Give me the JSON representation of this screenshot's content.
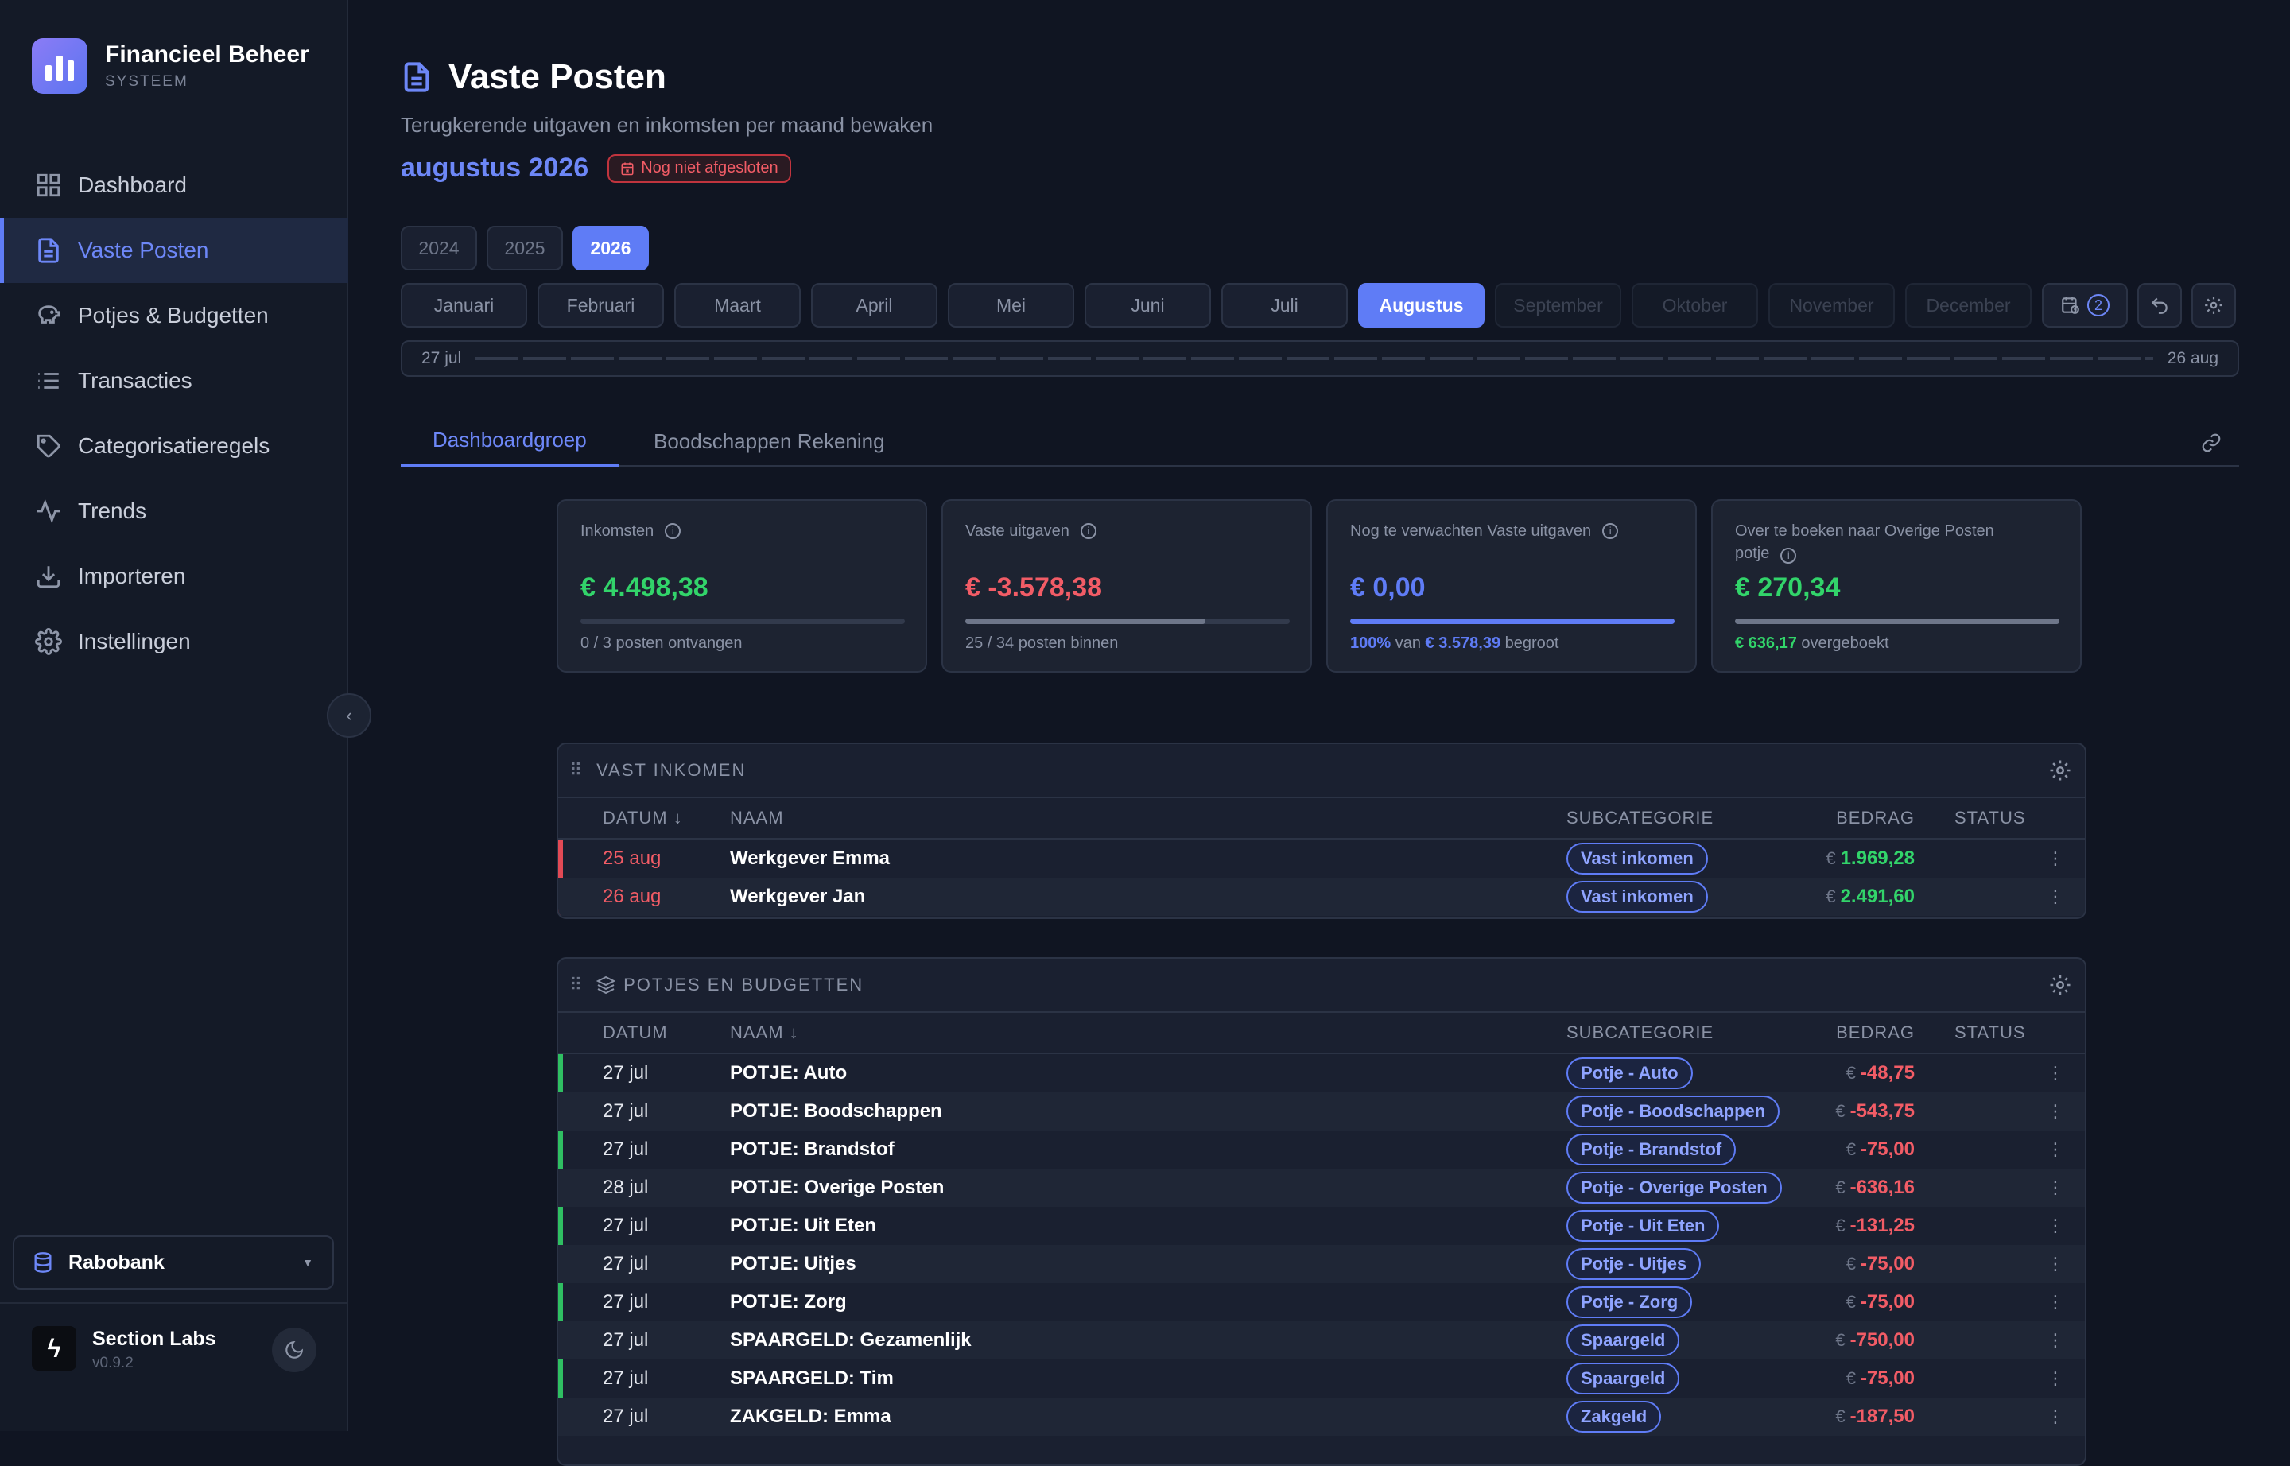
{
  "app": {
    "title": "Financieel Beheer",
    "subtitle": "SYSTEEM"
  },
  "sidebar": {
    "items": [
      {
        "label": "Dashboard",
        "icon": "grid-icon"
      },
      {
        "label": "Vaste Posten",
        "icon": "document-icon"
      },
      {
        "label": "Potjes & Budgetten",
        "icon": "piggy-bank-icon"
      },
      {
        "label": "Transacties",
        "icon": "list-icon"
      },
      {
        "label": "Categorisatieregels",
        "icon": "tag-icon"
      },
      {
        "label": "Trends",
        "icon": "activity-icon"
      },
      {
        "label": "Importeren",
        "icon": "download-icon"
      },
      {
        "label": "Instellingen",
        "icon": "gear-icon"
      }
    ],
    "collapse_glyph": "‹",
    "bank": "Rabobank",
    "company": "Section Labs",
    "version": "v0.9.2"
  },
  "header": {
    "title": "Vaste Posten",
    "subtitle": "Terugkerende uitgaven en inkomsten per maand bewaken",
    "month": "augustus 2026",
    "status_badge": "Nog niet afgesloten"
  },
  "years": [
    "2024",
    "2025",
    "2026"
  ],
  "active_year": "2026",
  "months": [
    "Januari",
    "Februari",
    "Maart",
    "April",
    "Mei",
    "Juni",
    "Juli",
    "Augustus",
    "September",
    "Oktober",
    "November",
    "December"
  ],
  "active_month": "Augustus",
  "pending_count": "2",
  "timeline": {
    "start": "27 jul",
    "end": "26 aug"
  },
  "tabs": [
    "Dashboardgroep",
    "Boodschappen Rekening"
  ],
  "cards": [
    {
      "label": "Inkomsten",
      "value": "€ 4.498,38",
      "progress": 0.0,
      "foot": "0 / 3 posten ontvangen"
    },
    {
      "label": "Vaste uitgaven",
      "value": "€ -3.578,38",
      "progress": 0.74,
      "foot": "25 / 34 posten binnen"
    },
    {
      "label": "Nog te verwachten Vaste uitgaven",
      "value": "€ 0,00",
      "progress": 1.0,
      "foot_pct": "100%",
      "foot_mid": "van",
      "foot_amt": "€ 3.578,39",
      "foot_end": "begroot"
    },
    {
      "label": "Over te boeken naar Overige Posten potje",
      "value": "€ 270,34",
      "progress": 1.0,
      "foot_amt": "€ 636,17",
      "foot_end": "overgeboekt"
    }
  ],
  "colors": {
    "accent": "#5f7cf6",
    "positive": "#32d46a",
    "negative": "#f25c66"
  },
  "income_panel": {
    "title": "VAST INKOMEN",
    "columns": {
      "date": "DATUM ↓",
      "name": "NAAM",
      "sub": "SUBCATEGORIE",
      "amount": "BEDRAG",
      "status": "STATUS"
    },
    "rows": [
      {
        "date": "25 aug",
        "name": "Werkgever Emma",
        "sub": "Vast inkomen",
        "currency": "€",
        "amount": "1.969,28"
      },
      {
        "date": "26 aug",
        "name": "Werkgever Jan",
        "sub": "Vast inkomen",
        "currency": "€",
        "amount": "2.491,60"
      }
    ]
  },
  "pots_panel": {
    "title": "POTJES EN BUDGETTEN",
    "columns": {
      "date": "DATUM",
      "name": "NAAM ↓",
      "sub": "SUBCATEGORIE",
      "amount": "BEDRAG",
      "status": "STATUS"
    },
    "rows": [
      {
        "date": "27 jul",
        "name": "POTJE: Auto",
        "sub": "Potje - Auto",
        "currency": "€",
        "amount": "-48,75"
      },
      {
        "date": "27 jul",
        "name": "POTJE: Boodschappen",
        "sub": "Potje - Boodschappen",
        "currency": "€",
        "amount": "-543,75"
      },
      {
        "date": "27 jul",
        "name": "POTJE: Brandstof",
        "sub": "Potje - Brandstof",
        "currency": "€",
        "amount": "-75,00"
      },
      {
        "date": "28 jul",
        "name": "POTJE: Overige Posten",
        "sub": "Potje - Overige Posten",
        "currency": "€",
        "amount": "-636,16"
      },
      {
        "date": "27 jul",
        "name": "POTJE: Uit Eten",
        "sub": "Potje - Uit Eten",
        "currency": "€",
        "amount": "-131,25"
      },
      {
        "date": "27 jul",
        "name": "POTJE: Uitjes",
        "sub": "Potje - Uitjes",
        "currency": "€",
        "amount": "-75,00"
      },
      {
        "date": "27 jul",
        "name": "POTJE: Zorg",
        "sub": "Potje - Zorg",
        "currency": "€",
        "amount": "-75,00"
      },
      {
        "date": "27 jul",
        "name": "SPAARGELD: Gezamenlijk",
        "sub": "Spaargeld",
        "currency": "€",
        "amount": "-750,00"
      },
      {
        "date": "27 jul",
        "name": "SPAARGELD: Tim",
        "sub": "Spaargeld",
        "currency": "€",
        "amount": "-75,00"
      },
      {
        "date": "27 jul",
        "name": "ZAKGELD: Emma",
        "sub": "Zakgeld",
        "currency": "€",
        "amount": "-187,50"
      }
    ]
  }
}
